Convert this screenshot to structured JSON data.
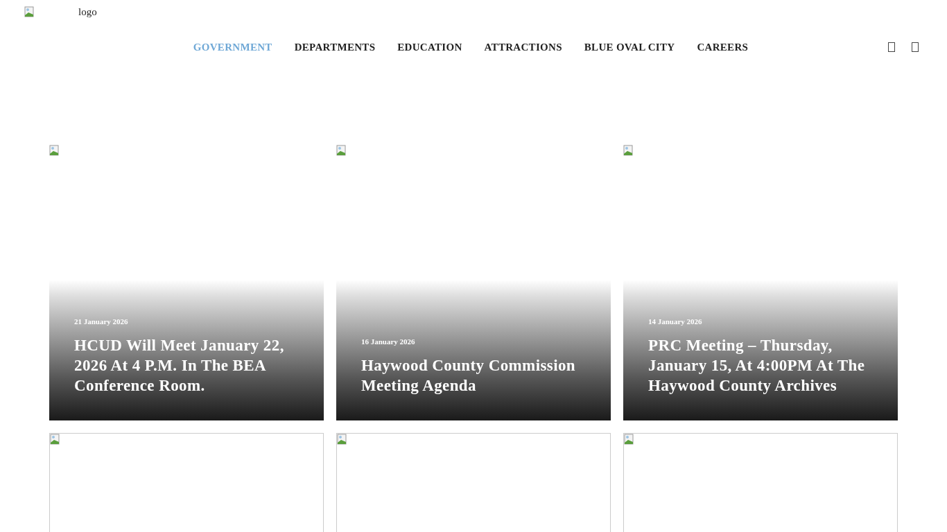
{
  "header": {
    "logo_alt": "logo"
  },
  "nav": [
    {
      "label": "GOVERNMENT",
      "selected": true
    },
    {
      "label": "DEPARTMENTS",
      "selected": false
    },
    {
      "label": "EDUCATION",
      "selected": false
    },
    {
      "label": "ATTRACTIONS",
      "selected": false
    },
    {
      "label": "BLUE OVAL CITY",
      "selected": false
    },
    {
      "label": "CAREERS",
      "selected": false
    }
  ],
  "posts": [
    {
      "kind": "overlay",
      "date": "21 January 2026",
      "title": "HCUD Will Meet January 22, 2026 At 4 P.M. In The BEA Conference Room."
    },
    {
      "kind": "overlay",
      "date": "16 January 2026",
      "title": "Haywood County Commission Meeting Agenda"
    },
    {
      "kind": "overlay",
      "date": "14 January 2026",
      "title": "PRC Meeting – Thursday, January 15, At 4:00PM At The Haywood County Archives"
    },
    {
      "kind": "plain"
    },
    {
      "kind": "plain"
    },
    {
      "kind": "plain"
    }
  ]
}
